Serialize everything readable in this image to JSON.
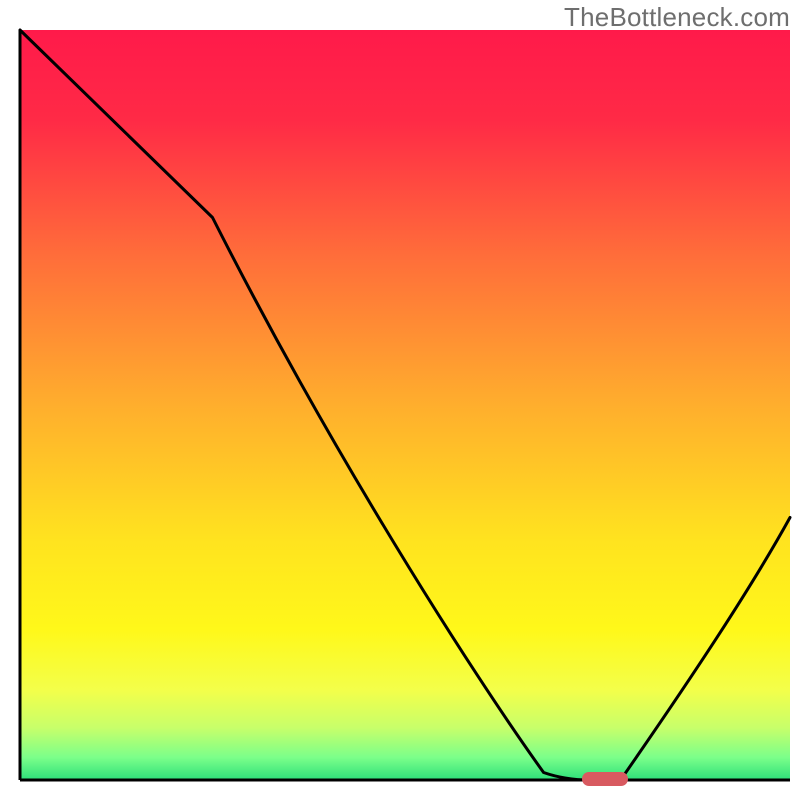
{
  "watermark": "TheBottleneck.com",
  "chart_data": {
    "type": "line",
    "title": "",
    "xlabel": "",
    "ylabel": "",
    "xlim": [
      0,
      100
    ],
    "ylim": [
      0,
      100
    ],
    "grid": false,
    "legend": false,
    "background_gradient_stops": [
      {
        "offset": 0.0,
        "color": "#ff1a4a"
      },
      {
        "offset": 0.12,
        "color": "#ff2a46"
      },
      {
        "offset": 0.3,
        "color": "#ff6d3a"
      },
      {
        "offset": 0.5,
        "color": "#ffae2d"
      },
      {
        "offset": 0.68,
        "color": "#ffe31f"
      },
      {
        "offset": 0.8,
        "color": "#fff81a"
      },
      {
        "offset": 0.88,
        "color": "#f3ff4a"
      },
      {
        "offset": 0.93,
        "color": "#c8ff6a"
      },
      {
        "offset": 0.97,
        "color": "#7bff8a"
      },
      {
        "offset": 1.0,
        "color": "#2de07a"
      }
    ],
    "series": [
      {
        "name": "bottleneck-curve",
        "x": [
          0,
          25,
          68,
          74,
          78,
          100
        ],
        "values": [
          100,
          75,
          1,
          0,
          0,
          35
        ]
      }
    ],
    "marker": {
      "name": "optimal-range",
      "x_center": 76,
      "y": 0,
      "width": 6,
      "color": "#d85a60"
    },
    "axes_color": "#000000"
  }
}
